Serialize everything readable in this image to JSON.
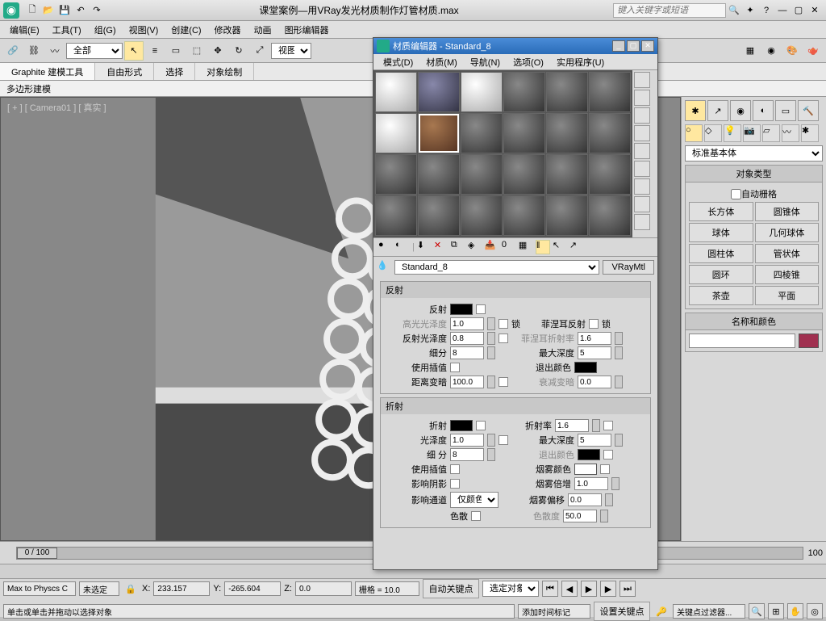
{
  "title": "课堂案例—用VRay发光材质制作灯管材质.max",
  "search_placeholder": "键入关键字或短语",
  "menus": [
    "编辑(E)",
    "工具(T)",
    "组(G)",
    "视图(V)",
    "创建(C)",
    "修改器",
    "动画",
    "图形编辑器"
  ],
  "toolbar_dropdown": "全部",
  "view_btn": "视图",
  "ribbon_tabs": [
    "Graphite 建模工具",
    "自由形式",
    "选择",
    "对象绘制"
  ],
  "subtab": "多边形建模",
  "viewport_label": "[ + ] [ Camera01 ] [ 真实 ]",
  "cmd_dropdown": "标准基本体",
  "obj_type_header": "对象类型",
  "auto_grid": "自动栅格",
  "primitives": [
    "长方体",
    "圆锥体",
    "球体",
    "几何球体",
    "圆柱体",
    "管状体",
    "圆环",
    "四棱锥",
    "茶壶",
    "平面"
  ],
  "name_color_header": "名称和颜色",
  "mat_editor": {
    "title": "材质编辑器 - Standard_8",
    "menus": [
      "模式(D)",
      "材质(M)",
      "导航(N)",
      "选项(O)",
      "实用程序(U)"
    ],
    "name": "Standard_8",
    "type": "VRayMtl",
    "reflection": {
      "header": "反射",
      "label": "反射",
      "hilight_gloss": "高光光泽度",
      "hilight_gloss_val": "1.0",
      "refl_gloss": "反射光泽度",
      "refl_gloss_val": "0.8",
      "subdivs": "细分",
      "subdivs_val": "8",
      "use_interp": "使用插值",
      "dim_distance": "距离变暗",
      "dim_distance_val": "100.0",
      "lock": "锁",
      "fresnel": "菲涅耳反射",
      "fresnel_ior": "菲涅耳折射率",
      "fresnel_ior_val": "1.6",
      "max_depth": "最大深度",
      "max_depth_val": "5",
      "exit_color": "退出颜色",
      "dim_falloff": "衰减变暗",
      "dim_falloff_val": "0.0"
    },
    "refraction": {
      "header": "折射",
      "label": "折射",
      "gloss": "光泽度",
      "gloss_val": "1.0",
      "subdivs": "细 分",
      "subdivs_val": "8",
      "use_interp": "使用插值",
      "affect_shadows": "影响阴影",
      "affect_channels": "影响通道",
      "affect_channels_val": "仅颜色",
      "ior": "折射率",
      "ior_val": "1.6",
      "max_depth": "最大深度",
      "max_depth_val": "5",
      "exit_color": "退出颜色",
      "fog_mult": "烟雾倍增",
      "fog_mult_val": "1.0",
      "fog_bias": "烟雾偏移",
      "fog_bias_val": "0.0",
      "dispersion": "色散",
      "dispersion_abbe": "色散度",
      "dispersion_abbe_val": "50.0"
    }
  },
  "timeline": {
    "frame": "0 / 100",
    "end": "100"
  },
  "status": {
    "selection": "未选定",
    "x": "233.157",
    "y": "-265.604",
    "z": "0.0",
    "grid": "栅格 = 10.0",
    "autokey": "自动关键点",
    "selected": "选定对象",
    "setkey": "设置关键点",
    "keyfilter": "关键点过滤器...",
    "script": "Max to Physcs C",
    "prompt": "单击或单击并拖动以选择对象",
    "addtag": "添加时间标记"
  }
}
